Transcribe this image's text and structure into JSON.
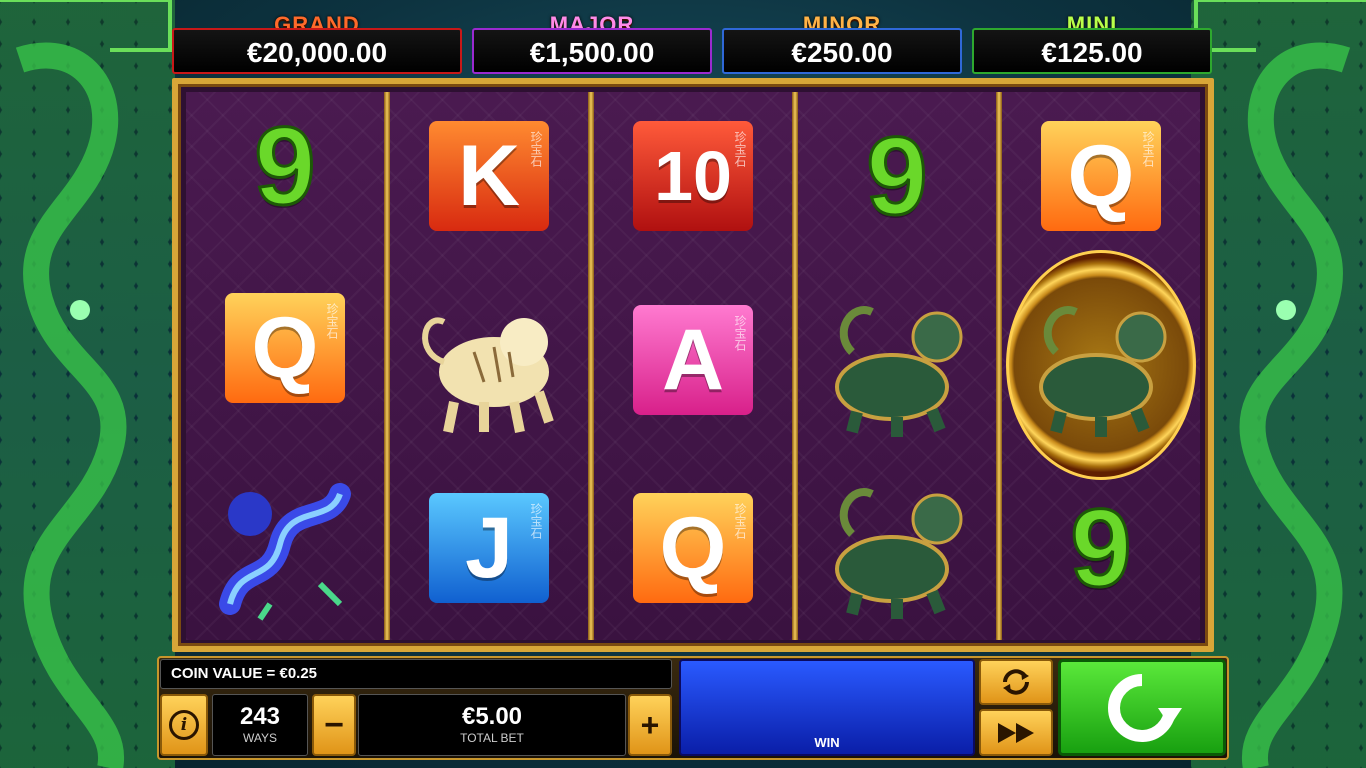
{
  "jackpots": [
    {
      "name": "GRAND",
      "value": "€20,000.00"
    },
    {
      "name": "MAJOR",
      "value": "€1,500.00"
    },
    {
      "name": "MINOR",
      "value": "€250.00"
    },
    {
      "name": "MINI",
      "value": "€125.00"
    }
  ],
  "reels": {
    "reel1": [
      "9",
      "Q",
      "blue-dragon"
    ],
    "reel2": [
      "K",
      "white-tiger",
      "J"
    ],
    "reel3": [
      "10",
      "A",
      "Q"
    ],
    "reel4": [
      "9",
      "turtle-dragon",
      "turtle-dragon"
    ],
    "reel5": [
      "Q",
      "turtle-dragon-wild",
      "9"
    ]
  },
  "symbol_glyph": "珍宝石",
  "controls": {
    "coin_value": "COIN VALUE = €0.25",
    "ways_value": "243",
    "ways_label": "WAYS",
    "minus": "−",
    "plus": "+",
    "total_bet_value": "€5.00",
    "total_bet_label": "TOTAL BET",
    "win_label": "WIN",
    "info": "i"
  },
  "icons": [
    "info-icon",
    "autoplay-icon",
    "turbo-icon",
    "spin-icon"
  ]
}
